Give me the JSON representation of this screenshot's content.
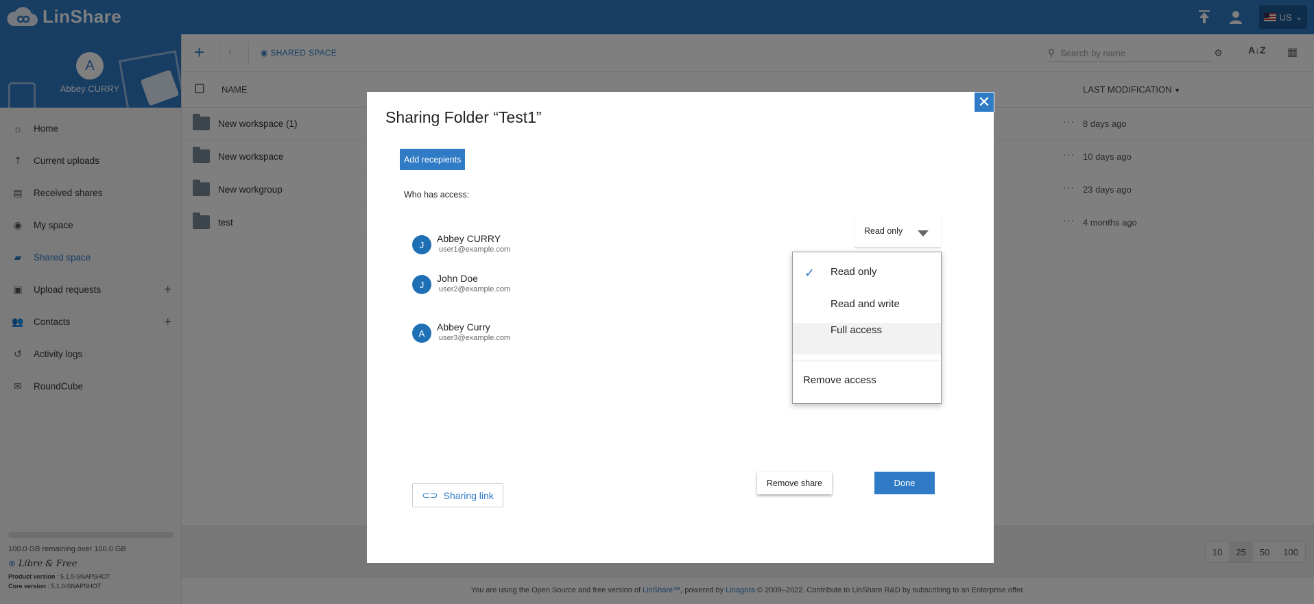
{
  "app": {
    "name": "LinShare",
    "language": "US"
  },
  "user": {
    "initial": "A",
    "name": "Abbey CURRY"
  },
  "sidebar": {
    "items": [
      {
        "label": "Home",
        "icon": "home-icon"
      },
      {
        "label": "Current uploads",
        "icon": "upload-icon"
      },
      {
        "label": "Received shares",
        "icon": "received-icon"
      },
      {
        "label": "My space",
        "icon": "person-icon"
      },
      {
        "label": "Shared space",
        "icon": "shared-icon",
        "active": true
      },
      {
        "label": "Upload requests",
        "icon": "request-icon",
        "plus": true
      },
      {
        "label": "Contacts",
        "icon": "contacts-icon",
        "plus": true
      },
      {
        "label": "Activity logs",
        "icon": "history-icon"
      },
      {
        "label": "RoundCube",
        "icon": "mail-icon"
      }
    ],
    "storage": "100.0 GB remaining over 100.0 GB",
    "libre": "Libre & Free",
    "product_version_label": "Product version",
    "product_version": ": 5.1.0-SNAPSHOT",
    "core_version_label": "Core version",
    "core_version": ": 5.1.0-SNAPSHOT"
  },
  "toolbar": {
    "breadcrumb": "SHARED SPACE",
    "search_placeholder": "Search by name"
  },
  "list": {
    "col_name": "NAME",
    "col_modified": "LAST MODIFICATION",
    "rows": [
      {
        "name": "New workspace (1)",
        "date": "8 days ago"
      },
      {
        "name": "New workspace",
        "date": "10 days ago"
      },
      {
        "name": "New workgroup",
        "date": "23 days ago"
      },
      {
        "name": "test",
        "date": "4 months ago"
      }
    ],
    "page_sizes": [
      "10",
      "25",
      "50",
      "100"
    ],
    "selected_page_size": "25"
  },
  "footer": {
    "pre": "You are using the Open Source and free version of ",
    "linshare": "LinShare™",
    "mid": ", powered by ",
    "linagora": "Linagora",
    "post": " © 2009–2022. Contribute to LinShare R&D by subscribing to an Enterprise offer."
  },
  "dialog": {
    "title": "Sharing Folder “Test1”",
    "add_recipients": "Add recepients",
    "who_has_access": "Who has access:",
    "members": [
      {
        "initial": "J",
        "name": "Abbey CURRY",
        "email": "user1@example.com"
      },
      {
        "initial": "J",
        "name": "John Doe",
        "email": "user2@example.com"
      },
      {
        "initial": "A",
        "name": "Abbey Curry",
        "email": "user3@example.com"
      }
    ],
    "role_selected": "Read only",
    "menu": {
      "read_only": "Read only",
      "read_write": "Read and write",
      "full_access": "Full access",
      "remove_access": "Remove access"
    },
    "sharing_link": "Sharing link",
    "remove_share": "Remove share",
    "done": "Done"
  }
}
